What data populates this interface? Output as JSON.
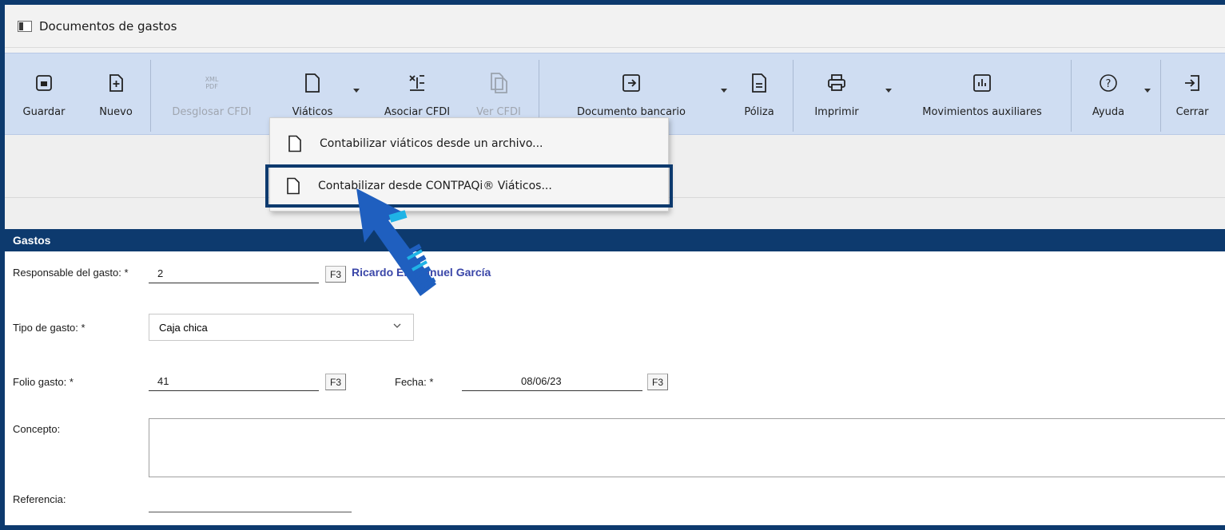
{
  "window": {
    "title": "Documentos de gastos"
  },
  "toolbar": {
    "guardar": "Guardar",
    "nuevo": "Nuevo",
    "desglosar_cfdi": "Desglosar CFDI",
    "viaticos": "Viáticos",
    "asociar_cfdi": "Asociar CFDI",
    "ver_cfdi": "Ver CFDI",
    "documento_bancario": "Documento bancario",
    "poliza": "Póliza",
    "imprimir": "Imprimir",
    "movimientos_auxiliares": "Movimientos auxiliares",
    "ayuda": "Ayuda",
    "cerrar": "Cerrar",
    "xml_pdf_icon_text": "XML\nPDF"
  },
  "menu": {
    "items": [
      {
        "label": "Contabilizar viáticos desde un archivo..."
      },
      {
        "label": "Contabilizar desde CONTPAQi® Viáticos..."
      }
    ]
  },
  "section": {
    "title": "Gastos"
  },
  "form": {
    "responsable_label": "Responsable del gasto: *",
    "responsable_value": "2",
    "responsable_name": "Ricardo Emmanuel García",
    "f3": "F3",
    "tipo_label": "Tipo de gasto: *",
    "tipo_value": "Caja chica",
    "folio_label": "Folio gasto: *",
    "folio_value": "41",
    "fecha_label": "Fecha: *",
    "fecha_value": "08/06/23",
    "concepto_label": "Concepto:",
    "referencia_label": "Referencia:"
  },
  "colors": {
    "accent_navy": "#0d3a6e",
    "ribbon": "#cfddf2",
    "arrow_blue": "#1f5fbf",
    "arrow_cyan": "#1fb3e6"
  }
}
